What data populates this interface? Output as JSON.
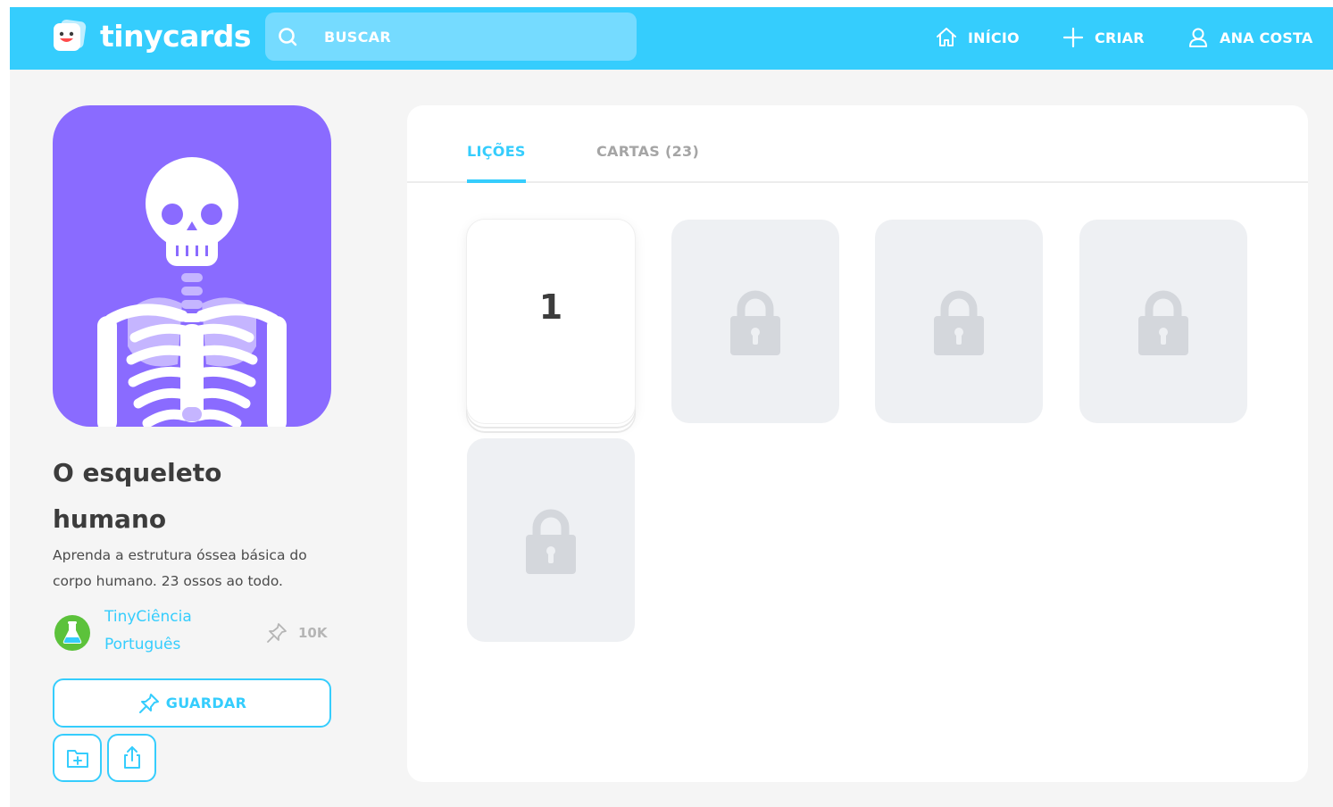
{
  "header": {
    "app_name": "tinycards",
    "search_placeholder": "BUSCAR",
    "nav": {
      "home": "INÍCIO",
      "create": "CRIAR",
      "user": "ANA COSTA"
    }
  },
  "deck": {
    "title": "O esqueleto humano",
    "description": "Aprenda a estrutura óssea básica do corpo humano. 23 ossos ao todo.",
    "author": "TinyCiência Português",
    "saves": "10K",
    "save_button": "GUARDAR"
  },
  "tabs": {
    "lessons": "LIÇÕES",
    "cards": "CARTAS (23)"
  },
  "lessons": [
    {
      "number": "1",
      "locked": false
    },
    {
      "locked": true
    },
    {
      "locked": true
    },
    {
      "locked": true
    },
    {
      "locked": true
    }
  ],
  "colors": {
    "brand": "#35cdfd",
    "cover_bg": "#8a6bff",
    "locked_card": "#eef0f3"
  }
}
